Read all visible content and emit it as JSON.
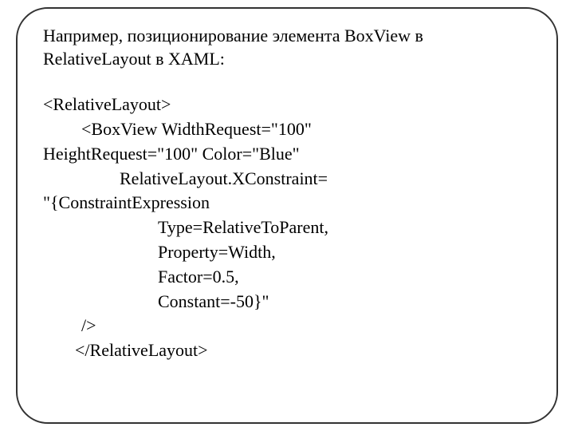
{
  "intro": "Например, позиционирование элемента BoxView в RelativeLayout в XAML:",
  "lines": {
    "l0": "<RelativeLayout>",
    "l1a": "<BoxView WidthRequest=\"100\" ",
    "l1b": "HeightRequest=\"100\" Color=\"Blue\"",
    "l2a": "RelativeLayout.XConstraint= ",
    "l2b": "\"{ConstraintExpression",
    "l3": "Type=RelativeToParent,",
    "l4": "Property=Width,",
    "l5": "Factor=0.5,",
    "l6": "Constant=-50}\"",
    "l7": "/>",
    "l8": "</RelativeLayout>"
  }
}
